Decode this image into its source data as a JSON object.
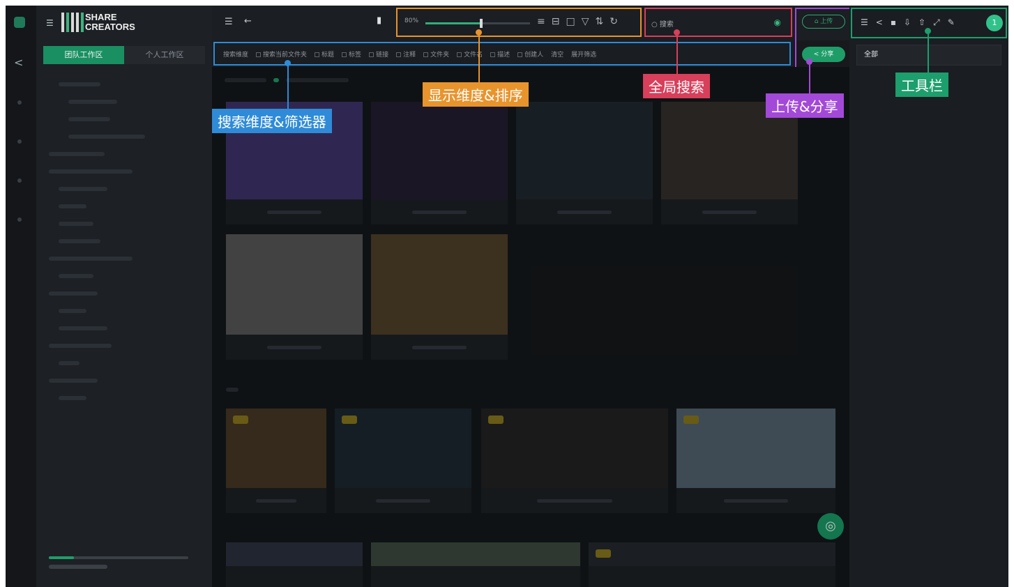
{
  "app": {
    "logo_line1": "SHARE",
    "logo_line2": "CREATORS"
  },
  "sidebar": {
    "tabs": [
      {
        "label": "团队工作区",
        "active": true
      },
      {
        "label": "个人工作区",
        "active": false
      }
    ]
  },
  "topbar": {
    "zoom_label": "80%",
    "zoom_value": 0.52,
    "search_placeholder": "搜索",
    "upload_label": "上传",
    "share_label": "分享"
  },
  "filters": {
    "items": [
      {
        "label": "搜索维度",
        "checkbox": false
      },
      {
        "label": "搜索当前文件夹",
        "checkbox": true
      },
      {
        "label": "标题",
        "checkbox": true
      },
      {
        "label": "标签",
        "checkbox": true
      },
      {
        "label": "链接",
        "checkbox": true
      },
      {
        "label": "注释",
        "checkbox": true
      },
      {
        "label": "文件夹",
        "checkbox": true
      },
      {
        "label": "文件名",
        "checkbox": true
      },
      {
        "label": "描述",
        "checkbox": true
      },
      {
        "label": "创建人",
        "checkbox": true
      },
      {
        "label": "清空",
        "checkbox": false
      },
      {
        "label": "展开筛选",
        "checkbox": false
      }
    ]
  },
  "right_panel": {
    "avatar_letter": "1",
    "select_value": "全部"
  },
  "annotations": {
    "search_filters": "搜索维度&筛选器",
    "display_sort": "显示维度&排序",
    "global_search": "全局搜索",
    "upload_share": "上传&分享",
    "toolbar": "工具栏"
  },
  "colors": {
    "accent_green": "#1a8f62",
    "annotation_blue": "#2f8bd8",
    "annotation_orange": "#e8942d",
    "annotation_red": "#d83f5b",
    "annotation_purple": "#a349d8",
    "annotation_teal": "#1d9e6d"
  }
}
